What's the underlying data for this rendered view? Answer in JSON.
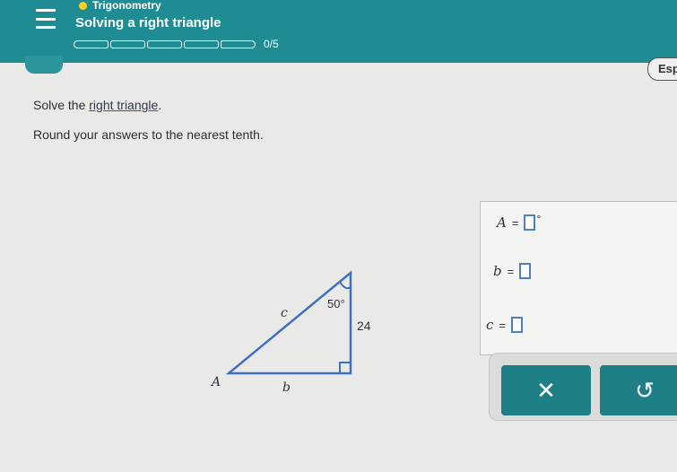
{
  "header": {
    "topic": "Trigonometry",
    "title": "Solving a right triangle",
    "progress_text": "0/5",
    "progress_segments": 5,
    "progress_completed": 0,
    "colors": {
      "bar": "#1f8c93",
      "topic_dot": "#f4d21f"
    }
  },
  "language_button": {
    "label": "Esp"
  },
  "instructions": {
    "line1_before": "Solve the ",
    "line1_link": "right triangle",
    "line1_after": ".",
    "line2": "Round your answers to the nearest tenth."
  },
  "figure": {
    "vertex_label_A": "A",
    "side_label_c": "c",
    "side_label_b": "b",
    "angle_label": "50°",
    "side_value": "24"
  },
  "answers": {
    "A_label": "A",
    "b_label": "b",
    "c_label": "c",
    "equals": "=",
    "degree_symbol": "°"
  },
  "buttons": {
    "clear_symbol": "✕",
    "undo_symbol": "↺"
  }
}
